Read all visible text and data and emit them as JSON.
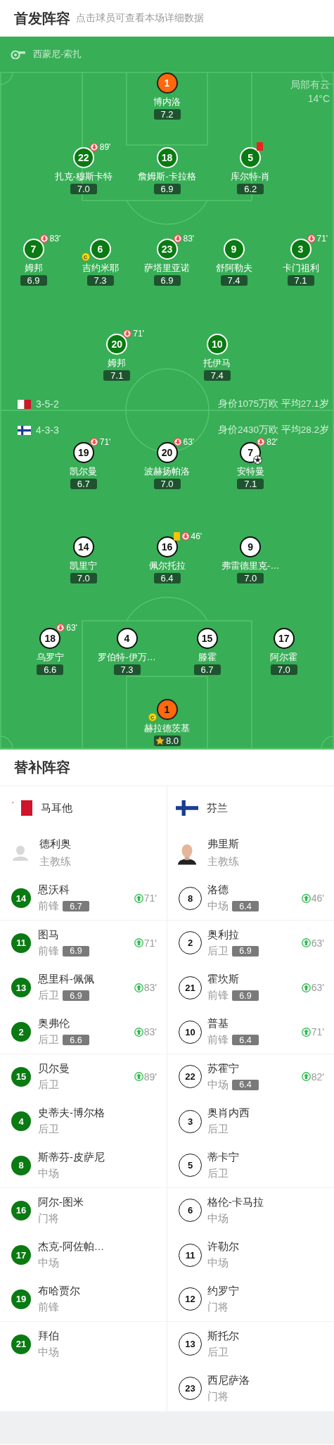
{
  "lineup": {
    "title": "首发阵容",
    "hint": "点击球员可查看本场详细数据",
    "referee": "西蒙尼-索扎",
    "weather": {
      "condition": "局部有云",
      "temperature": "14°C"
    },
    "teams": [
      {
        "kind": "home",
        "formation": "3-5-2",
        "summary": "身价1075万欧 平均27.1岁",
        "lines": [
          [
            {
              "number": "1",
              "name": "博内洛",
              "rating": "7.2",
              "kind": "gk"
            }
          ],
          [
            {
              "number": "22",
              "name": "扎克-穆斯卡特",
              "rating": "7.0",
              "kind": "field",
              "sub_out": "89'"
            },
            {
              "number": "18",
              "name": "詹姆斯-卡拉格",
              "rating": "6.9",
              "kind": "field"
            },
            {
              "number": "5",
              "name": "库尔特-肖",
              "rating": "6.2",
              "kind": "field",
              "red_card": true
            }
          ],
          [
            {
              "number": "7",
              "name": "姆邦",
              "rating": "6.9",
              "kind": "field",
              "sub_out": "83'"
            },
            {
              "number": "6",
              "name": "吉约米耶",
              "rating": "7.3",
              "kind": "field",
              "captain_badge": "C"
            },
            {
              "number": "23",
              "name": "萨塔里亚诺",
              "rating": "6.9",
              "kind": "field",
              "sub_out": "83'"
            },
            {
              "number": "9",
              "name": "舒阿勒夫",
              "rating": "7.4",
              "kind": "field"
            },
            {
              "number": "3",
              "name": "卡门祖利",
              "rating": "7.1",
              "kind": "field",
              "sub_out": "71'"
            }
          ],
          [
            {
              "number": "20",
              "name": "姆邦",
              "rating": "7.1",
              "kind": "field",
              "sub_out": "71'"
            },
            {
              "number": "10",
              "name": "托伊马",
              "rating": "7.4",
              "kind": "field"
            }
          ]
        ]
      },
      {
        "kind": "away",
        "formation": "4-3-3",
        "summary": "身价2430万欧 平均28.2岁",
        "lines": [
          [
            {
              "number": "19",
              "name": "凯尔曼",
              "rating": "6.7",
              "kind": "field",
              "sub_out": "71'"
            },
            {
              "number": "20",
              "name": "波赫扬帕洛",
              "rating": "7.0",
              "kind": "field",
              "sub_out": "63'"
            },
            {
              "number": "7",
              "name": "安特曼",
              "rating": "7.1",
              "kind": "field",
              "sub_out": "82'",
              "goal": true
            }
          ],
          [
            {
              "number": "14",
              "name": "凯里宁",
              "rating": "7.0",
              "kind": "field"
            },
            {
              "number": "16",
              "name": "佩尔托拉",
              "rating": "6.4",
              "kind": "field",
              "yellow_card": true,
              "sub_out": "46'"
            },
            {
              "number": "9",
              "name": "弗雷德里克-…",
              "rating": "7.0",
              "kind": "field"
            }
          ],
          [
            {
              "number": "18",
              "name": "乌罗宁",
              "rating": "6.6",
              "kind": "field",
              "sub_out": "63'"
            },
            {
              "number": "4",
              "name": "罗伯特-伊万…",
              "rating": "7.3",
              "kind": "field"
            },
            {
              "number": "15",
              "name": "滕霍",
              "rating": "6.7",
              "kind": "field"
            },
            {
              "number": "17",
              "name": "阿尔霍",
              "rating": "7.0",
              "kind": "field"
            }
          ],
          [
            {
              "number": "1",
              "name": "赫拉德茨基",
              "rating": "8.0",
              "kind": "gk",
              "captain_badge": "C",
              "star": true
            }
          ]
        ]
      }
    ]
  },
  "substitutes": {
    "title": "替补阵容",
    "teams": [
      {
        "name": "马耳他",
        "kind": "home",
        "coach": {
          "name": "德利奥",
          "role": "主教练",
          "photo": false
        },
        "players": [
          {
            "number": "14",
            "name": "恩沃科",
            "position": "前锋",
            "rating": "6.7",
            "sub_in": "71'"
          },
          {
            "number": "11",
            "name": "图马",
            "position": "前锋",
            "rating": "6.9",
            "sub_in": "71'"
          },
          {
            "number": "13",
            "name": "恩里科-佩佩",
            "position": "后卫",
            "rating": "6.9",
            "sub_in": "83'"
          },
          {
            "number": "2",
            "name": "奥弗伦",
            "position": "后卫",
            "rating": "6.6",
            "sub_in": "83'"
          },
          {
            "number": "15",
            "name": "贝尔曼",
            "position": "后卫",
            "sub_in": "89'"
          },
          {
            "number": "4",
            "name": "史蒂夫-博尔格",
            "position": "后卫"
          },
          {
            "number": "8",
            "name": "斯蒂芬-皮萨尼",
            "position": "中场"
          },
          {
            "number": "16",
            "name": "阿尔-图米",
            "position": "门将"
          },
          {
            "number": "17",
            "name": "杰克-阿佐帕…",
            "position": "中场"
          },
          {
            "number": "19",
            "name": "布哈贾尔",
            "position": "前锋"
          },
          {
            "number": "21",
            "name": "拜伯",
            "position": "中场"
          }
        ]
      },
      {
        "name": "芬兰",
        "kind": "away",
        "coach": {
          "name": "弗里斯",
          "role": "主教练",
          "photo": true
        },
        "players": [
          {
            "number": "8",
            "name": "洛德",
            "position": "中场",
            "rating": "6.4",
            "sub_in": "46'"
          },
          {
            "number": "2",
            "name": "奥利拉",
            "position": "后卫",
            "rating": "6.9",
            "sub_in": "63'"
          },
          {
            "number": "21",
            "name": "霍坎斯",
            "position": "前锋",
            "rating": "6.9",
            "sub_in": "63'"
          },
          {
            "number": "10",
            "name": "普基",
            "position": "前锋",
            "rating": "6.4",
            "sub_in": "71'"
          },
          {
            "number": "22",
            "name": "苏霍宁",
            "position": "中场",
            "rating": "6.4",
            "sub_in": "82'"
          },
          {
            "number": "3",
            "name": "奥肖内西",
            "position": "后卫"
          },
          {
            "number": "5",
            "name": "蒂卡宁",
            "position": "后卫"
          },
          {
            "number": "6",
            "name": "格伦-卡马拉",
            "position": "中场"
          },
          {
            "number": "11",
            "name": "许勒尔",
            "position": "中场"
          },
          {
            "number": "12",
            "name": "约罗宁",
            "position": "门将"
          },
          {
            "number": "13",
            "name": "斯托尔",
            "position": "后卫"
          },
          {
            "number": "23",
            "name": "西尼萨洛",
            "position": "门将"
          }
        ]
      }
    ]
  }
}
